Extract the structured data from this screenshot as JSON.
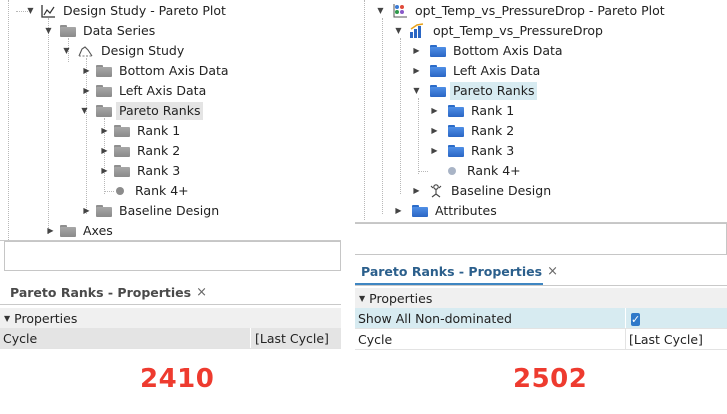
{
  "left": {
    "tree": {
      "root": "Design Study - Pareto Plot",
      "data_series": "Data Series",
      "design_study": "Design Study",
      "bottom_axis": "Bottom Axis Data",
      "left_axis": "Left Axis Data",
      "pareto_ranks": "Pareto Ranks",
      "rank1": "Rank 1",
      "rank2": "Rank 2",
      "rank3": "Rank 3",
      "rank4": "Rank 4+",
      "baseline": "Baseline Design",
      "axes": "Axes"
    },
    "properties": {
      "tab_title": "Pareto Ranks - Properties",
      "close": "×",
      "section": "Properties",
      "rows": [
        {
          "name": "Cycle",
          "value": "[Last Cycle]"
        }
      ]
    },
    "version": "2410"
  },
  "right": {
    "tree": {
      "root": "opt_Temp_vs_PressureDrop - Pareto Plot",
      "series": "opt_Temp_vs_PressureDrop",
      "bottom_axis": "Bottom Axis Data",
      "left_axis": "Left Axis Data",
      "pareto_ranks": "Pareto Ranks",
      "rank1": "Rank 1",
      "rank2": "Rank 2",
      "rank3": "Rank 3",
      "rank4": "Rank 4+",
      "baseline": "Baseline Design",
      "attributes": "Attributes"
    },
    "properties": {
      "tab_title": "Pareto Ranks - Properties",
      "close": "×",
      "section": "Properties",
      "rows": [
        {
          "name": "Show All Non-dominated",
          "value": "",
          "checked": true
        },
        {
          "name": "Cycle",
          "value": "[Last Cycle]"
        }
      ]
    },
    "version": "2502"
  },
  "colors": {
    "version_red": "#ee3b2f",
    "selection_gray": "#e4e4e4",
    "selection_blue": "#d7ebf1",
    "folder_blue": "#2f6fcf",
    "folder_gray": "#999999",
    "tab_blue": "#3f86c2"
  }
}
